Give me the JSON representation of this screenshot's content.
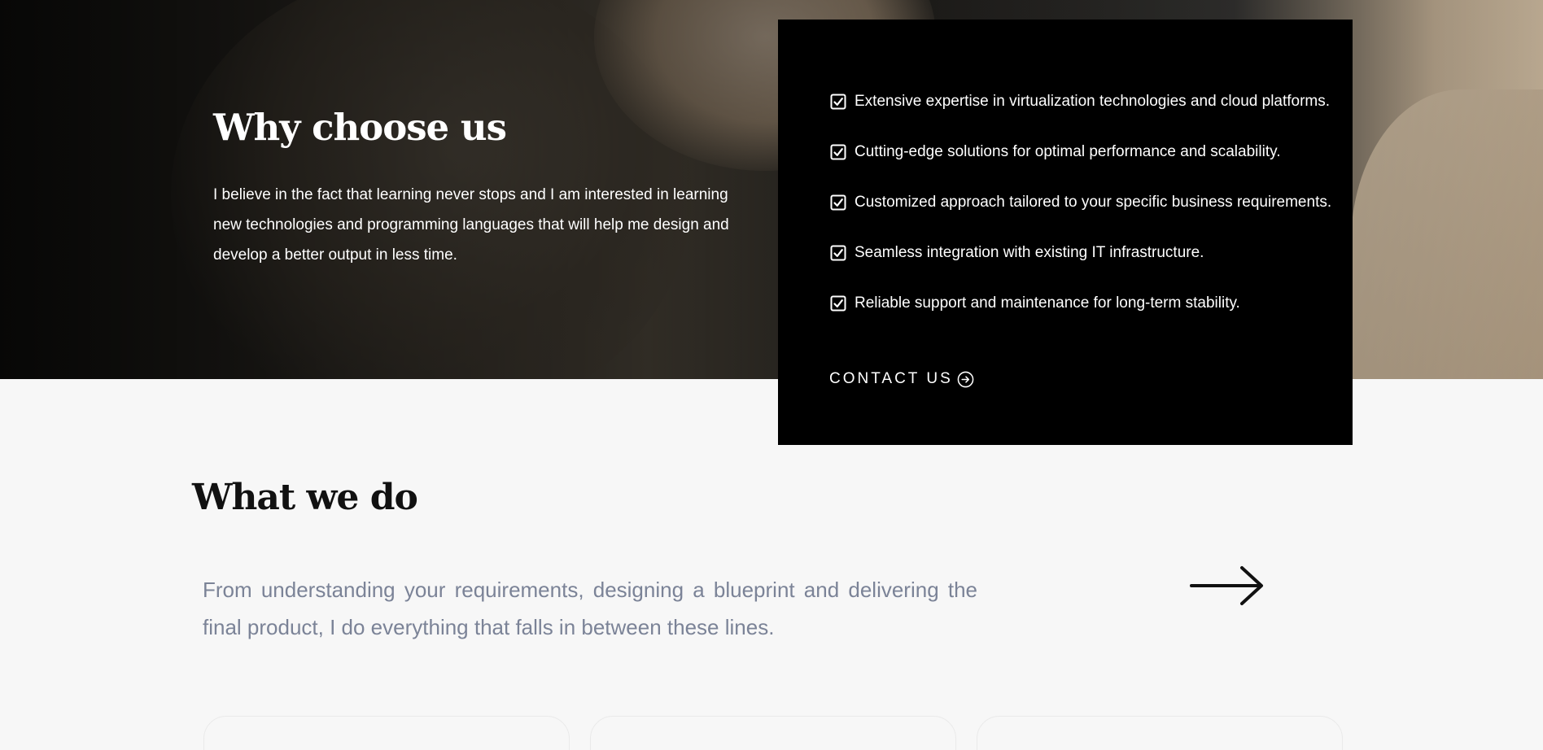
{
  "hero": {
    "title": "Why choose us",
    "description": "I believe in the fact that learning never stops and I am interested in learning new technologies and programming languages that will help me design and develop a better output in less time."
  },
  "features": {
    "items": [
      {
        "label": "Extensive expertise in virtualization technologies and cloud platforms.",
        "icon": "checkbox-checked-icon"
      },
      {
        "label": "Cutting-edge solutions for optimal performance and scalability.",
        "icon": "checkbox-checked-icon"
      },
      {
        "label": "Customized approach tailored to your specific business requirements.",
        "icon": "checkbox-checked-icon"
      },
      {
        "label": "Seamless integration with existing IT infrastructure.",
        "icon": "checkbox-checked-icon"
      },
      {
        "label": "Reliable support and maintenance for long-term stability.",
        "icon": "checkbox-checked-icon"
      }
    ],
    "contact_label": "CONTACT US",
    "contact_icon": "arrow-circle-right-icon"
  },
  "what_we_do": {
    "title": "What we do",
    "description": "From understanding your requirements, designing a blueprint and delivering the final product, I do everything that falls in between these lines.",
    "arrow_icon": "arrow-right-icon"
  },
  "colors": {
    "card_background": "#000000",
    "page_background": "#f7f7f7",
    "description_text": "#7b8397"
  }
}
